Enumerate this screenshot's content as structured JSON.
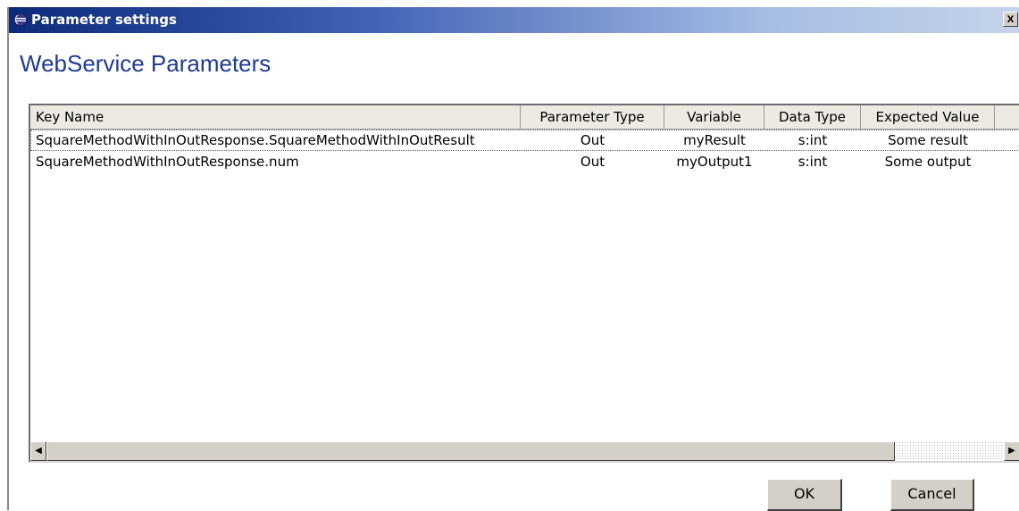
{
  "window": {
    "title": "Parameter settings",
    "close_label": "x"
  },
  "heading": "WebService Parameters",
  "table": {
    "columns": [
      "Key Name",
      "Parameter Type",
      "Variable",
      "Data Type",
      "Expected Value"
    ],
    "rows": [
      {
        "key_name": "SquareMethodWithInOutResponse.SquareMethodWithInOutResult",
        "parameter_type": "Out",
        "variable": "myResult",
        "data_type": "s:int",
        "expected_value": "Some result"
      },
      {
        "key_name": "SquareMethodWithInOutResponse.num",
        "parameter_type": "Out",
        "variable": "myOutput1",
        "data_type": "s:int",
        "expected_value": "Some output"
      }
    ],
    "selected_row": 0
  },
  "scrollbar": {
    "left_arrow": "◀",
    "right_arrow": "▶"
  },
  "buttons": {
    "ok": "OK",
    "cancel": "Cancel"
  },
  "colors": {
    "title_gradient_start": "#0b2a7a",
    "title_gradient_end": "#c6d3ea",
    "heading": "#1f3a93",
    "button_face": "#d4d0c8"
  }
}
